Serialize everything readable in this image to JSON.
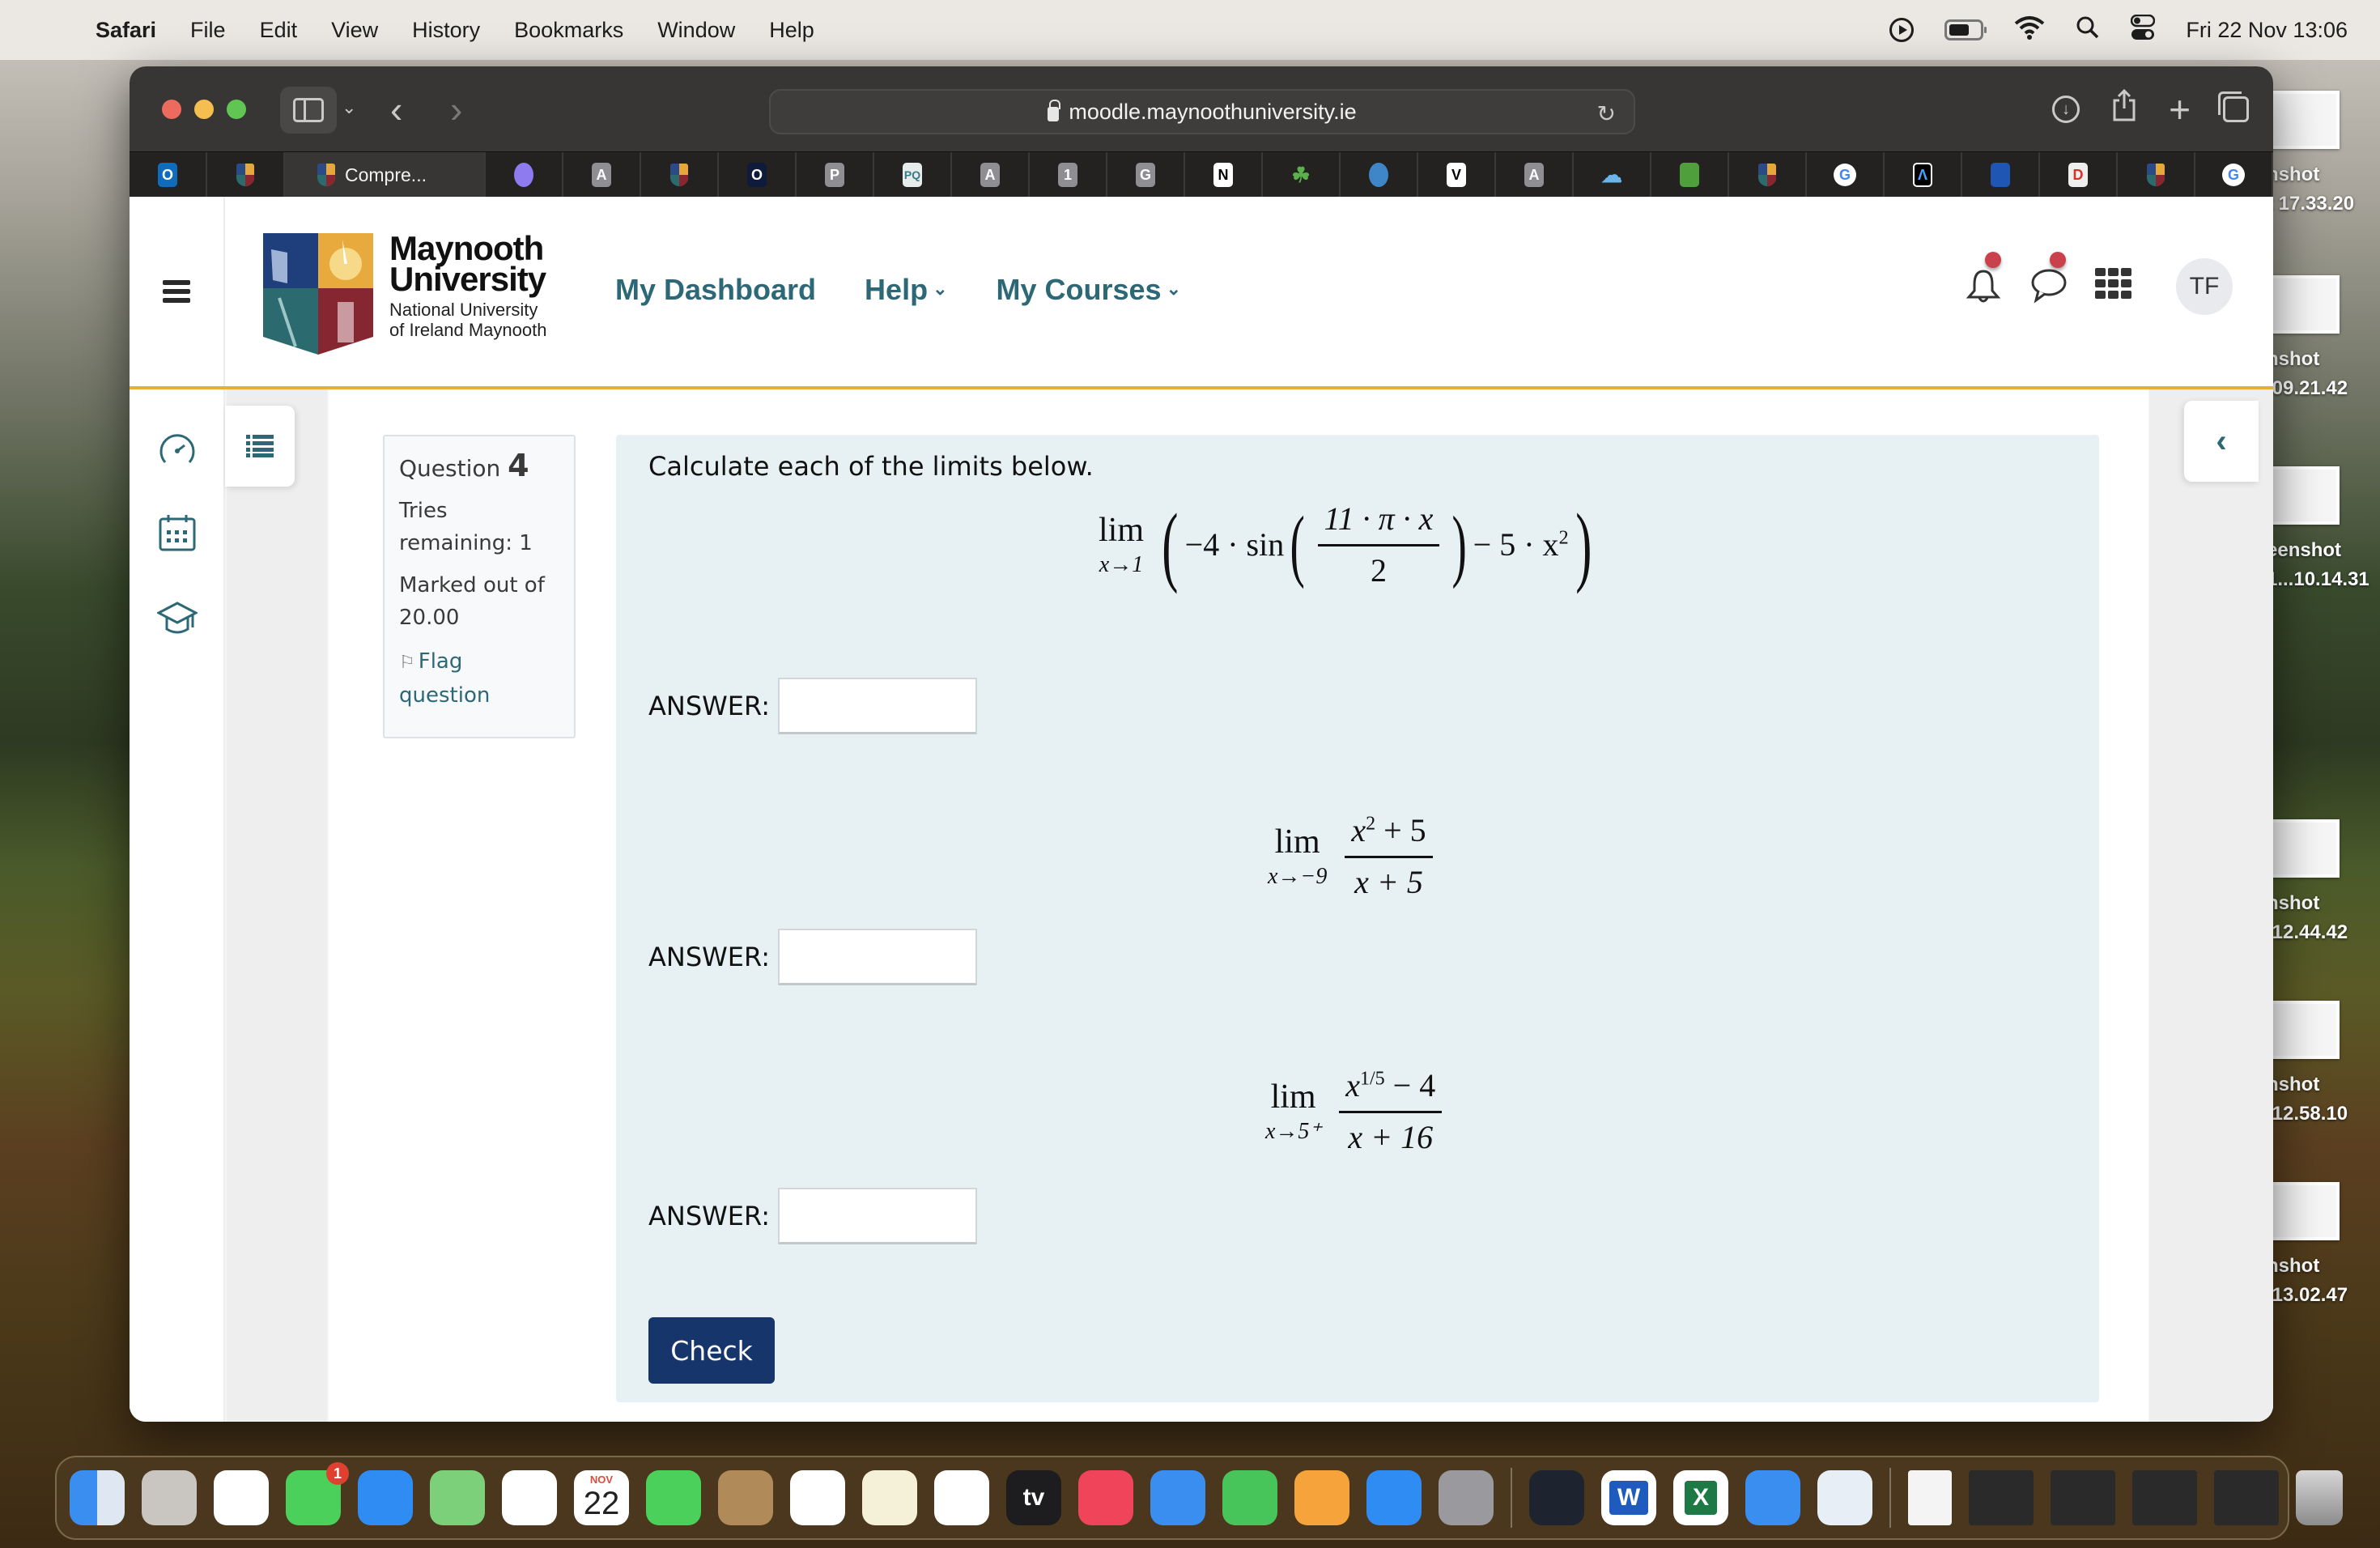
{
  "menubar": {
    "app_name": "Safari",
    "items": [
      "File",
      "Edit",
      "View",
      "History",
      "Bookmarks",
      "Window",
      "Help"
    ],
    "status_icons": [
      "play-circle-icon",
      "battery-icon",
      "wifi-icon",
      "spotlight-search-icon",
      "control-center-icon"
    ],
    "clock": "Fri 22 Nov  13:06"
  },
  "desktop": {
    "files": [
      {
        "line1": "nshot",
        "line2": "t 17.33.20"
      },
      {
        "line1": "nshot",
        "line2": ".09.21.42"
      },
      {
        "line1": "eenshot",
        "line2": "1...10.14.31"
      },
      {
        "line1": "nshot",
        "line2": ".12.44.42"
      },
      {
        "line1": "nshot",
        "line2": ".12.58.10"
      },
      {
        "line1": "nshot",
        "line2": ".13.02.47"
      }
    ]
  },
  "browser": {
    "url": "moodle.maynoothuniversity.ie",
    "active_tab_title": "Compre...",
    "tabs": [
      {
        "icon": "outlook-icon",
        "label": "O"
      },
      {
        "icon": "maynooth-crest-icon",
        "label": ""
      },
      {
        "icon": "maynooth-crest-icon",
        "label": "Compre...",
        "active": true
      },
      {
        "icon": "crystal-icon",
        "label": ""
      },
      {
        "icon": "letter-a-icon",
        "label": "A"
      },
      {
        "icon": "maynooth-crest-icon",
        "label": ""
      },
      {
        "icon": "circle-o-icon",
        "label": "O"
      },
      {
        "icon": "letter-p-icon",
        "label": "P"
      },
      {
        "icon": "pq-icon",
        "label": "PQ"
      },
      {
        "icon": "letter-a-icon",
        "label": "A"
      },
      {
        "icon": "number-1-icon",
        "label": "1"
      },
      {
        "icon": "letter-g-icon",
        "label": "G"
      },
      {
        "icon": "notion-icon",
        "label": "N"
      },
      {
        "icon": "shamrock-icon",
        "label": "☘"
      },
      {
        "icon": "globe-icon",
        "label": ""
      },
      {
        "icon": "v-logo-icon",
        "label": "V"
      },
      {
        "icon": "letter-a-icon",
        "label": "A"
      },
      {
        "icon": "cloud-icon",
        "label": ""
      },
      {
        "icon": "leaf-icon",
        "label": ""
      },
      {
        "icon": "maynooth-crest-icon",
        "label": ""
      },
      {
        "icon": "google-icon",
        "label": "G"
      },
      {
        "icon": "a-caret-icon",
        "label": "Λ"
      },
      {
        "icon": "blue-square-icon",
        "label": ""
      },
      {
        "icon": "letter-d-icon",
        "label": "D"
      },
      {
        "icon": "maynooth-crest-icon",
        "label": ""
      },
      {
        "icon": "google-icon",
        "label": "G"
      }
    ]
  },
  "site": {
    "logo": {
      "line1": "Maynooth",
      "line2": "University",
      "line3": "National University",
      "line4": "of Ireland Maynooth"
    },
    "nav": {
      "dashboard": "My Dashboard",
      "help": "Help",
      "courses": "My Courses"
    },
    "user_initials": "TF",
    "colors": {
      "accent": "#2d6877",
      "header_rule": "#e8ad3b",
      "button": "#16356a",
      "notification_dot": "#c8414c",
      "question_bg": "#e7f0f3"
    }
  },
  "question": {
    "label": "Question",
    "number": "4",
    "tries": "Tries remaining: 1",
    "marked": "Marked out of 20.00",
    "flag": "Flag question",
    "prompt": "Calculate each of the limits below.",
    "limits": [
      {
        "lim": "lim",
        "sub": "x→1",
        "pre": "−4 · sin",
        "num": "11 · π · x",
        "den": "2",
        "post": "− 5 · x",
        "post_sup": "2"
      },
      {
        "lim": "lim",
        "sub": "x→−9",
        "num_base": "x",
        "num_sup": "2",
        "num_rest": " + 5",
        "den": "x + 5"
      },
      {
        "lim": "lim",
        "sub": "x→5⁺",
        "num_base": "x",
        "num_sup": "1/5",
        "num_rest": " − 4",
        "den": "x + 16"
      }
    ],
    "answer_label": "ANSWER:",
    "answers": [
      "",
      "",
      ""
    ],
    "check_label": "Check"
  },
  "dock": {
    "apps": [
      {
        "name": "Finder"
      },
      {
        "name": "Launchpad"
      },
      {
        "name": "Safari"
      },
      {
        "name": "Messages",
        "badge": "1"
      },
      {
        "name": "Mail"
      },
      {
        "name": "Maps"
      },
      {
        "name": "Photos"
      },
      {
        "name": "Calendar",
        "month": "NOV",
        "day": "22"
      },
      {
        "name": "FaceTime"
      },
      {
        "name": "Contacts"
      },
      {
        "name": "Reminders"
      },
      {
        "name": "Notes"
      },
      {
        "name": "Freeform"
      },
      {
        "name": "TV",
        "label": "tv"
      },
      {
        "name": "Music"
      },
      {
        "name": "Keynote"
      },
      {
        "name": "Numbers"
      },
      {
        "name": "Pages"
      },
      {
        "name": "App Store"
      },
      {
        "name": "System Settings"
      },
      {
        "name": "Stocks"
      },
      {
        "name": "Word",
        "label": "W"
      },
      {
        "name": "Excel",
        "label": "X"
      },
      {
        "name": "Wireless Diagnostics"
      },
      {
        "name": "Preview"
      }
    ]
  }
}
